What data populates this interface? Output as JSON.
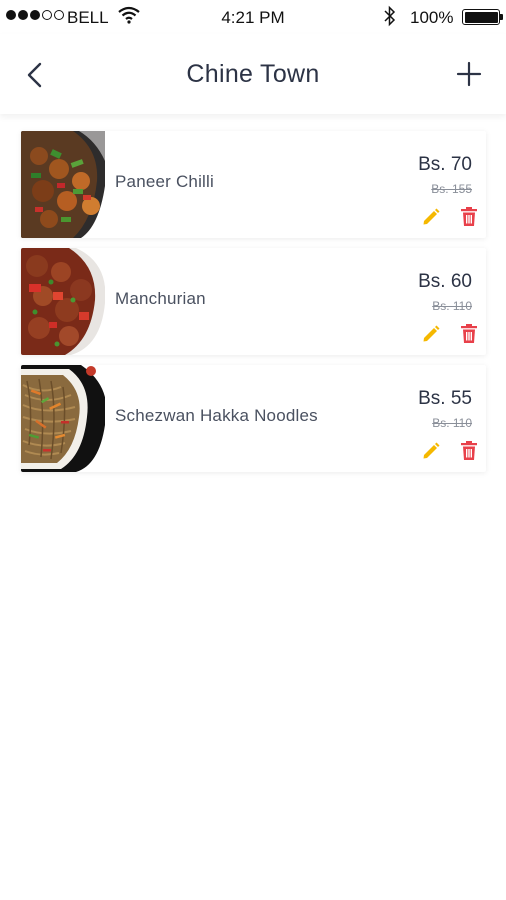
{
  "status_bar": {
    "carrier": "BELL",
    "time": "4:21 PM",
    "battery": "100%"
  },
  "nav": {
    "title": "Chine Town"
  },
  "items": [
    {
      "name": "Paneer Chilli",
      "price": "Bs. 70",
      "old_price": "Bs. 155",
      "image": "paneer-chilli-dish"
    },
    {
      "name": "Manchurian",
      "price": "Bs. 60",
      "old_price": "Bs. 110",
      "image": "manchurian-dish"
    },
    {
      "name": "Schezwan Hakka Noodles",
      "price": "Bs. 55",
      "old_price": "Bs. 110",
      "image": "hakka-noodles-dish"
    }
  ],
  "colors": {
    "edit": "#f5b800",
    "delete": "#e8404a",
    "title": "#2c3345"
  },
  "icons": {
    "back": "chevron-left-icon",
    "add": "plus-icon",
    "edit": "pencil-icon",
    "delete": "trash-icon"
  }
}
